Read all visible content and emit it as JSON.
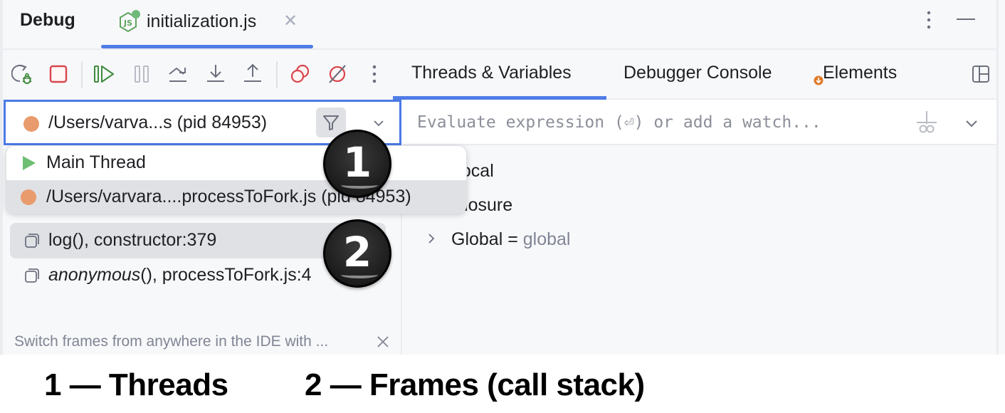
{
  "titlebar": {
    "title": "Debug",
    "session_tab": {
      "label": "initialization.js",
      "icon": "nodejs-icon",
      "close_icon": "close-icon"
    },
    "more_icon": "more-vertical-icon",
    "minimize_icon": "minimize-icon"
  },
  "toolbar": {
    "buttons": [
      {
        "name": "rerun-debug",
        "icon": "rerun-debug-icon",
        "enabled": true
      },
      {
        "name": "stop",
        "icon": "stop-icon",
        "enabled": true
      },
      {
        "name": "resume",
        "icon": "resume-icon",
        "enabled": true
      },
      {
        "name": "pause",
        "icon": "pause-icon",
        "enabled": false
      },
      {
        "name": "step-over",
        "icon": "step-over-icon",
        "enabled": true
      },
      {
        "name": "step-into",
        "icon": "step-into-icon",
        "enabled": true
      },
      {
        "name": "step-out",
        "icon": "step-out-icon",
        "enabled": true
      },
      {
        "name": "view-breakpoints",
        "icon": "view-breakpoints-icon",
        "enabled": true
      },
      {
        "name": "mute-breakpoints",
        "icon": "mute-breakpoints-icon",
        "enabled": true
      },
      {
        "name": "more",
        "icon": "more-vertical-icon",
        "enabled": true
      }
    ]
  },
  "right_tabs": [
    {
      "label": "Threads & Variables",
      "active": true
    },
    {
      "label": "Debugger Console",
      "active": false
    },
    {
      "label": "Elements",
      "active": false,
      "badge_icon": "download-badge-icon"
    }
  ],
  "thread_selector": {
    "value": "/Users/varva...s (pid 84953)",
    "status_color": "#e99b6d",
    "filter_icon": "filter-icon",
    "chevron_icon": "chevron-down-icon"
  },
  "thread_popup": {
    "items": [
      {
        "label": "Main Thread",
        "icon": "play-icon",
        "color": "#6fbf73",
        "selected": false
      },
      {
        "label": "/Users/varvara....processToFork.js (pid 84953)",
        "icon": "process-dot-icon",
        "color": "#e99b6d",
        "selected": true
      }
    ]
  },
  "evaluate": {
    "placeholder": "Evaluate expression (⏎) or add a watch...",
    "value": "",
    "add_watch_icon": "add-watch-icon",
    "chevron_icon": "chevron-down-icon"
  },
  "frames": [
    {
      "function": "log()",
      "location": ", constructor:379",
      "italic": false,
      "selected": true
    },
    {
      "function": "anonymous",
      "suffix": "()",
      "location": ", processToFork.js:4",
      "italic": true,
      "selected": false
    }
  ],
  "frames_hint": {
    "text": "Switch frames from anywhere in the IDE with ...",
    "close_icon": "close-icon"
  },
  "variables": [
    {
      "name": "Local",
      "expandable": false
    },
    {
      "name": "Closure",
      "expandable": false
    },
    {
      "name": "Global",
      "separator": " = ",
      "value": "global",
      "expandable": true
    }
  ],
  "callouts": [
    {
      "number": "1",
      "target": "threads"
    },
    {
      "number": "2",
      "target": "frames"
    }
  ],
  "caption": {
    "item1": "1 — Threads",
    "item2": "2 — Frames (call stack)"
  },
  "colors": {
    "accent": "#4f7ce6",
    "panel_bg": "#f7f8fa",
    "selection_bg": "#dfe1e5",
    "stop_red": "#d9454c",
    "resume_green": "#3e8a3e",
    "process_orange": "#e99b6d"
  }
}
